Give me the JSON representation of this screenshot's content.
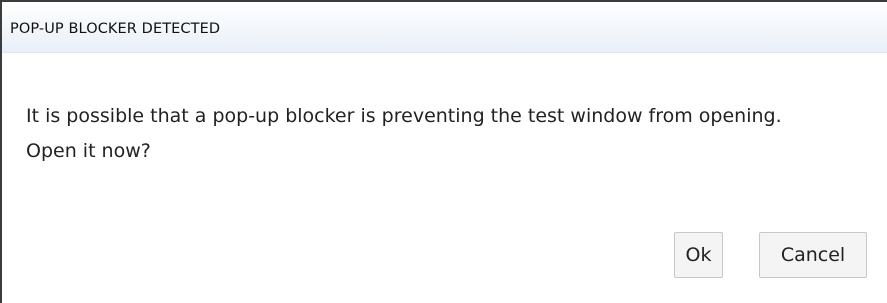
{
  "dialog": {
    "title": "POP-UP BLOCKER DETECTED",
    "message": "It is possible that a pop-up blocker is preventing the test window from opening. Open it now?",
    "buttons": {
      "ok_label": "Ok",
      "cancel_label": "Cancel"
    }
  }
}
